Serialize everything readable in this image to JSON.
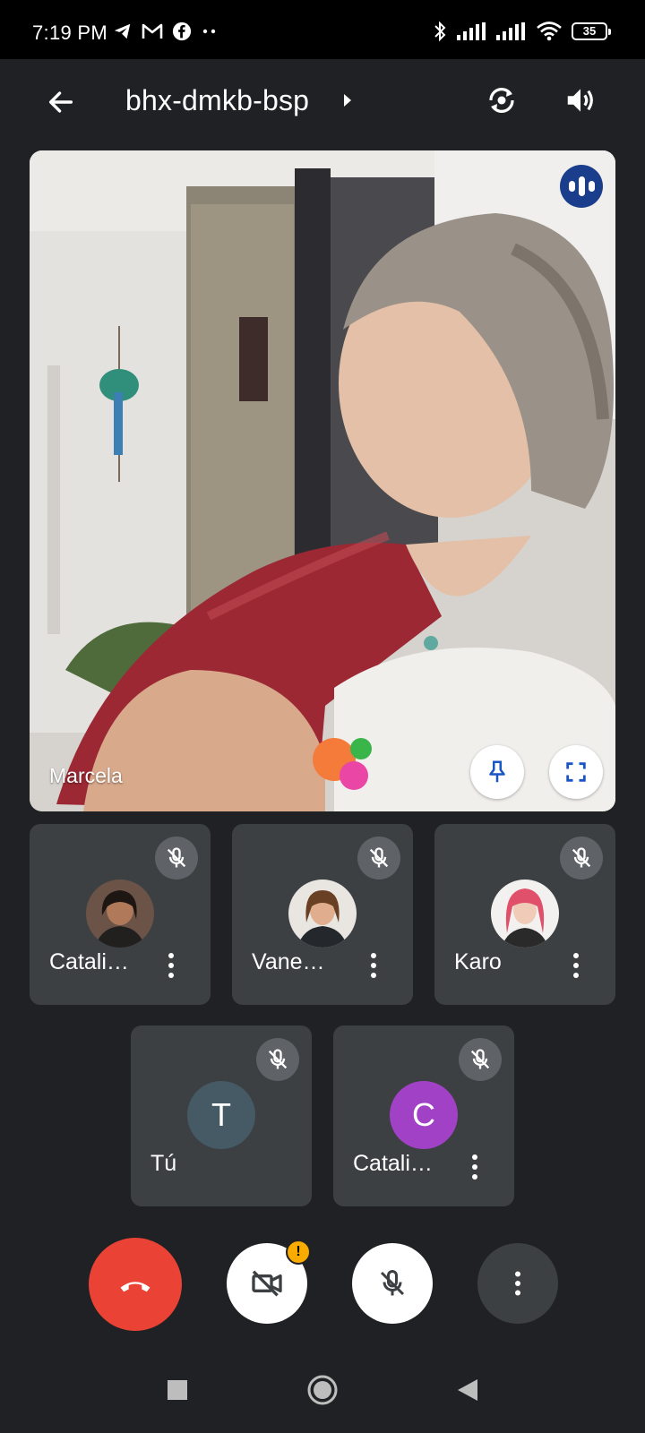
{
  "status_bar": {
    "time": "7:19 PM",
    "battery": "35",
    "left_icons": [
      "telegram-icon",
      "gmail-icon",
      "facebook-icon",
      "more-dots-icon"
    ],
    "right_icons": [
      "bluetooth-icon",
      "signal-icon",
      "signal-icon",
      "wifi-icon",
      "battery-icon"
    ]
  },
  "top_bar": {
    "meeting_code": "bhx-dmkb-bsp",
    "icons": [
      "back-arrow-icon",
      "chevron-right-icon",
      "switch-camera-icon",
      "speaker-icon"
    ]
  },
  "main_video": {
    "participant_name": "Marcela",
    "speaking": true,
    "actions": [
      "pin-icon",
      "fullscreen-icon"
    ]
  },
  "participants": [
    {
      "name": "Catali…",
      "avatar_type": "photo",
      "muted": true,
      "has_menu": true
    },
    {
      "name": "Vane…",
      "avatar_type": "photo",
      "muted": true,
      "has_menu": true
    },
    {
      "name": "Karo",
      "avatar_type": "photo",
      "muted": true,
      "has_menu": true
    },
    {
      "name": "Tú",
      "avatar_type": "initial",
      "initial": "T",
      "avatar_color": "#455a64",
      "muted": true,
      "has_menu": false
    },
    {
      "name": "Catali…",
      "avatar_type": "initial",
      "initial": "C",
      "avatar_color": "#a142c6",
      "muted": true,
      "has_menu": true
    }
  ],
  "controls": {
    "buttons": [
      "end-call-icon",
      "camera-off-icon",
      "mic-off-icon",
      "more-options-icon"
    ],
    "camera_warning": "!",
    "end_call_color": "#ea4335"
  },
  "nav_bar": {
    "buttons": [
      "recents-square-icon",
      "home-circle-icon",
      "back-triangle-icon"
    ]
  }
}
